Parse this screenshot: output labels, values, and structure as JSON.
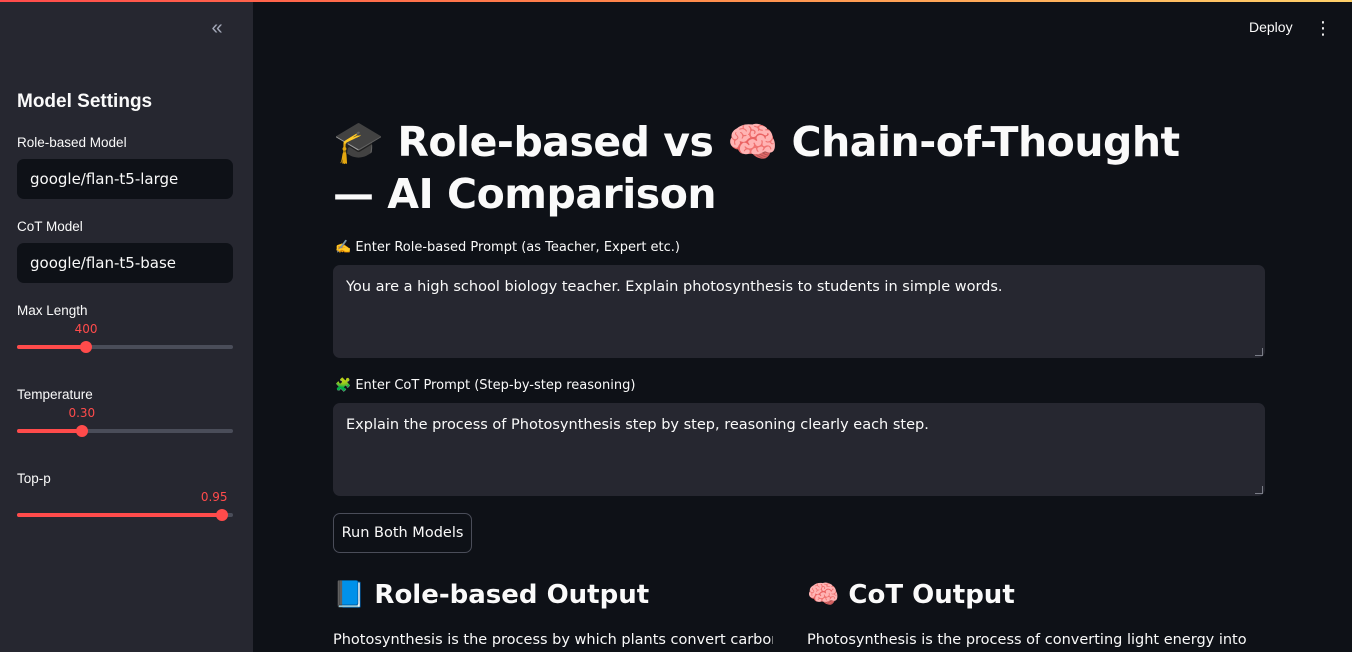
{
  "sidebar": {
    "collapse_icon": "«",
    "heading": "Model Settings",
    "role_model_label": "Role-based Model",
    "role_model_value": "google/flan-t5-large",
    "cot_model_label": "CoT Model",
    "cot_model_value": "google/flan-t5-base",
    "max_length": {
      "label": "Max Length",
      "value": "400",
      "fraction": 0.32
    },
    "temperature": {
      "label": "Temperature",
      "value": "0.30",
      "fraction": 0.3
    },
    "top_p": {
      "label": "Top-p",
      "value": "0.95",
      "fraction": 0.95
    }
  },
  "header": {
    "deploy_label": "Deploy",
    "menu_icon": "⋮"
  },
  "main": {
    "title": "🎓 Role-based vs 🧠 Chain-of-Thought — AI Comparison",
    "role_prompt_label": "✍️ Enter Role-based Prompt (as Teacher, Expert etc.)",
    "role_prompt_value": "You are a high school biology teacher. Explain photosynthesis to students in simple words.",
    "cot_prompt_label": "🧩 Enter CoT Prompt (Step-by-step reasoning)",
    "cot_prompt_value": "Explain the process of Photosynthesis step by step, reasoning clearly each step.",
    "run_button": "Run Both Models",
    "role_output_heading": "📘 Role-based Output",
    "role_output_text": "Photosynthesis is the process by which plants convert carbon",
    "cot_output_heading": "🧠 CoT Output",
    "cot_output_text": "Photosynthesis is the process of converting light energy into light"
  },
  "colors": {
    "accent": "#ff4b4b",
    "background": "#0e1117",
    "sidebar": "#262730"
  }
}
